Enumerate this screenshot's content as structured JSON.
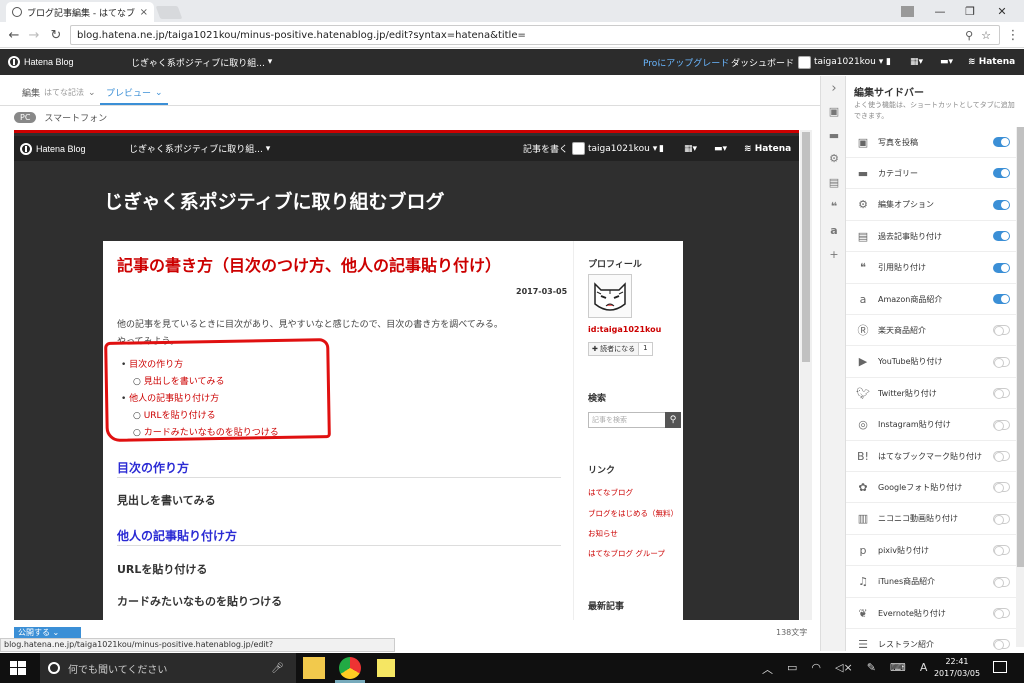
{
  "browser": {
    "tab_title": "ブログ記事編集 - はてなブロ",
    "url": "blog.hatena.ne.jp/taiga1021kou/minus-positive.hatenablog.jp/edit?syntax=hatena&title="
  },
  "hatena_bar": {
    "logo": "Hatena Blog",
    "blog_name": "じぎゃく系ポジティブに取り組...",
    "upgrade": "Proにアップグレード",
    "dashboard": "ダッシュボード",
    "user": "taiga1021kou",
    "hatena": "Hatena"
  },
  "editor": {
    "tab_edit": "編集",
    "tab_edit_sub": "はてな記法",
    "tab_preview": "プレビュー",
    "view_pc": "PC",
    "view_sp": "スマートフォン"
  },
  "preview": {
    "bar_logo": "Hatena Blog",
    "bar_blog_name": "じぎゃく系ポジティブに取り組...",
    "bar_write": "記事を書く",
    "bar_user": "taiga1021kou",
    "bar_hatena": "Hatena",
    "blog_title": "じぎゃく系ポジティブに取り組むブログ",
    "entry_title": "記事の書き方（目次のつけ方、他人の記事貼り付け）",
    "entry_date": "2017-03-05",
    "intro_line1": "他の記事を見ているときに目次があり、見やすいなと感じたので、目次の書き方を調べてみる。",
    "intro_line2": "やってみよう。",
    "toc": [
      {
        "label": "目次の作り方",
        "children": [
          "見出しを書いてみる"
        ]
      },
      {
        "label": "他人の記事貼り付け方",
        "children": [
          "URLを貼り付ける",
          "カードみたいなものを貼りつける"
        ]
      }
    ],
    "sections": [
      {
        "h": "目次の作り方",
        "level": 3
      },
      {
        "h": "見出しを書いてみる",
        "level": 4
      },
      {
        "h": "他人の記事貼り付け方",
        "level": 3
      },
      {
        "h": "URLを貼り付ける",
        "level": 4
      },
      {
        "h": "カードみたいなものを貼りつける",
        "level": 4
      }
    ],
    "side": {
      "profile_h": "プロフィール",
      "profile_id": "id:taiga1021kou",
      "reader_btn": "読者になる",
      "reader_count": "1",
      "search_h": "検索",
      "search_placeholder": "記事を検索",
      "links_h": "リンク",
      "links": [
        "はてなブログ",
        "ブログをはじめる（無料）",
        "お知らせ",
        "はてなブログ グループ"
      ],
      "recent_h": "最新記事"
    },
    "char_count": "138文字"
  },
  "publish_btn": "公開する",
  "sidebar": {
    "title": "編集サイドバー",
    "desc": "よく使う機能は、ショートカットとしてタブに追加できます。",
    "items": [
      {
        "icon": "photo-icon",
        "label": "写真を投稿",
        "on": true
      },
      {
        "icon": "folder-icon",
        "label": "カテゴリー",
        "on": true
      },
      {
        "icon": "gear-icon",
        "label": "編集オプション",
        "on": true
      },
      {
        "icon": "document-icon",
        "label": "過去記事貼り付け",
        "on": true
      },
      {
        "icon": "quote-icon",
        "label": "引用貼り付け",
        "on": true
      },
      {
        "icon": "amazon-icon",
        "label": "Amazon商品紹介",
        "on": true
      },
      {
        "icon": "rakuten-icon",
        "label": "楽天商品紹介",
        "on": false
      },
      {
        "icon": "youtube-icon",
        "label": "YouTube貼り付け",
        "on": false
      },
      {
        "icon": "twitter-icon",
        "label": "Twitter貼り付け",
        "on": false
      },
      {
        "icon": "instagram-icon",
        "label": "Instagram貼り付け",
        "on": false
      },
      {
        "icon": "hatena-bookmark-icon",
        "label": "はてなブックマーク貼り付け",
        "on": false
      },
      {
        "icon": "google-photos-icon",
        "label": "Googleフォト貼り付け",
        "on": false
      },
      {
        "icon": "niconico-icon",
        "label": "ニコニコ動画貼り付け",
        "on": false
      },
      {
        "icon": "pixiv-icon",
        "label": "pixiv貼り付け",
        "on": false
      },
      {
        "icon": "itunes-icon",
        "label": "iTunes商品紹介",
        "on": false
      },
      {
        "icon": "evernote-icon",
        "label": "Evernote貼り付け",
        "on": false
      },
      {
        "icon": "restaurant-icon",
        "label": "レストラン紹介",
        "on": false
      }
    ]
  },
  "status_url": "blog.hatena.ne.jp/taiga1021kou/minus-positive.hatenablog.jp/edit?syntax=hatena&title=#preview",
  "taskbar": {
    "search_placeholder": "何でも聞いてください",
    "time": "22:41",
    "date": "2017/03/05"
  },
  "colors": {
    "accent": "#3b8fd6",
    "hatena_red": "#c00000",
    "bar_dark": "#2c2c2c"
  }
}
